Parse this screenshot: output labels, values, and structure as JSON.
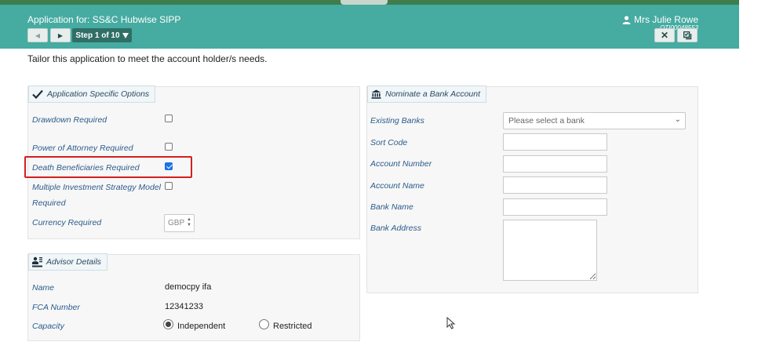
{
  "header": {
    "app_title": "Application for: SS&C Hubwise SIPP",
    "user_name": "Mrs Julie Rowe",
    "user_id": "OTI00048553",
    "step_label": "Step 1 of 10",
    "accent_color": "#46aba1"
  },
  "intro_text": "Tailor this application to meet the account holder/s needs.",
  "options_panel": {
    "title": "Application Specific Options",
    "items": [
      {
        "label": "Drawdown Required",
        "checked": false
      },
      {
        "label": "Power of Attorney Required",
        "checked": false
      },
      {
        "label": "Death Beneficiaries Required",
        "checked": true
      },
      {
        "label_line1": "Multiple Investment Strategy Model",
        "label_line2": "Required",
        "checked": false
      }
    ],
    "currency_label": "Currency Required",
    "currency_value": "GBP"
  },
  "advisor_panel": {
    "title": "Advisor Details",
    "name_label": "Name",
    "name_value": "democpy ifa",
    "fca_label": "FCA Number",
    "fca_value": "12341233",
    "capacity_label": "Capacity",
    "capacity_options": [
      {
        "label": "Independent",
        "selected": true
      },
      {
        "label": "Restricted",
        "selected": false
      }
    ]
  },
  "bank_panel": {
    "title": "Nominate a Bank Account",
    "existing_banks_label": "Existing Banks",
    "existing_banks_placeholder": "Please select a bank",
    "sort_code_label": "Sort Code",
    "account_number_label": "Account Number",
    "account_name_label": "Account Name",
    "bank_name_label": "Bank Name",
    "bank_address_label": "Bank Address"
  }
}
